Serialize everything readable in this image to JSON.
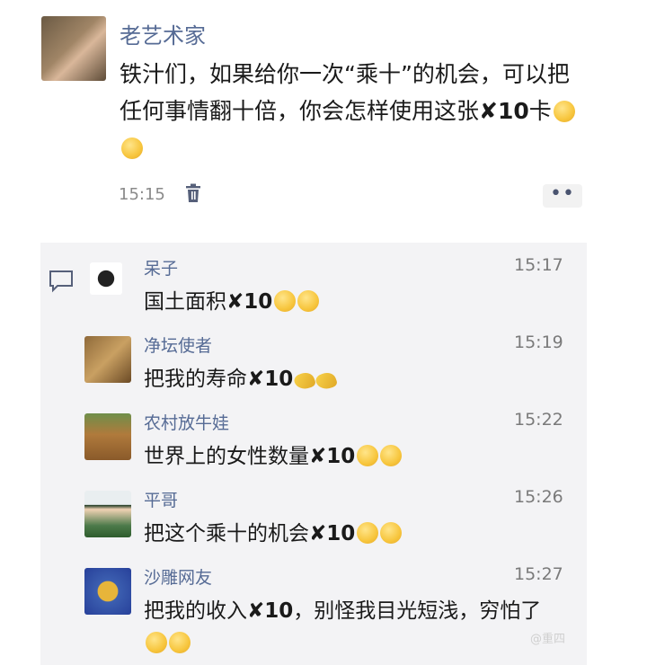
{
  "post": {
    "author": "老艺术家",
    "text_main": "铁汁们，如果给你一次“乘十”的机会，可以把任何事情翻十倍，你会怎样使用这张",
    "text_mult": "✘10",
    "text_end": "卡",
    "time": "15:15",
    "more": "••"
  },
  "comments": [
    {
      "name": "呆子",
      "time": "15:17",
      "text": "国土面积",
      "mult": "✘10",
      "emoji": "smile"
    },
    {
      "name": "净坛使者",
      "time": "15:19",
      "text": "把我的寿命",
      "mult": "✘10",
      "emoji": "banana"
    },
    {
      "name": "农村放牛娃",
      "time": "15:22",
      "text": "世界上的女性数量",
      "mult": "✘10",
      "emoji": "grin"
    },
    {
      "name": "平哥",
      "time": "15:26",
      "text": "把这个乘十的机会",
      "mult": "✘10",
      "emoji": "smile"
    },
    {
      "name": "沙雕网友",
      "time": "15:27",
      "text": "把我的收入",
      "mult": "✘10",
      "tail": "，别怪我目光短浅，穷怕了",
      "emoji": "shock"
    }
  ],
  "watermark": "@重四"
}
